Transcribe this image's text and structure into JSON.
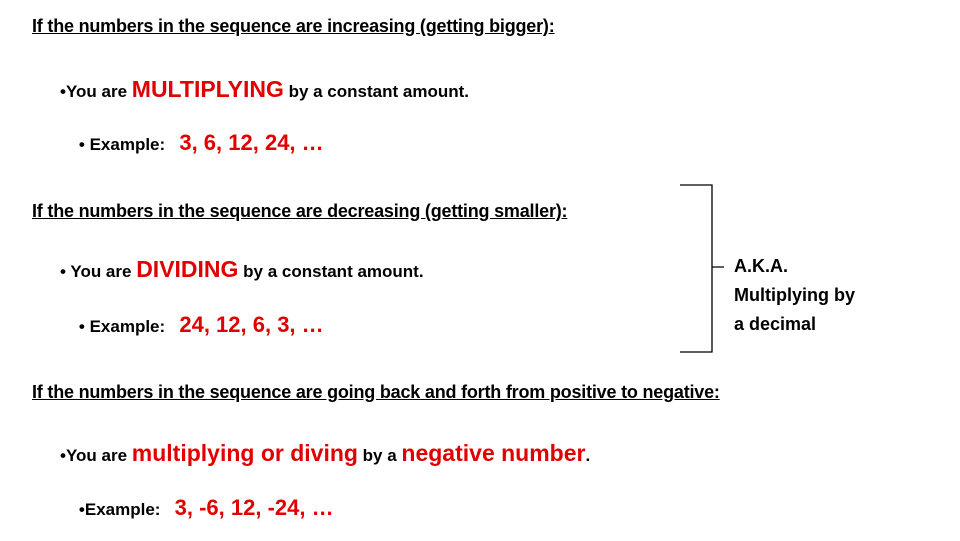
{
  "section1": {
    "heading": "If the numbers in the sequence are increasing (getting bigger):",
    "bullet1": {
      "prefix": "•You are ",
      "highlight": "MULTIPLYING",
      "suffix": " by a constant amount."
    },
    "bullet2": {
      "prefix": "• Example:   ",
      "example": "3, 6, 12, 24, …"
    }
  },
  "section2": {
    "heading": "If the numbers in the sequence are decreasing (getting smaller):",
    "bullet1": {
      "prefix": "• You are ",
      "highlight": "DIVIDING",
      "suffix": " by a constant amount."
    },
    "bullet2": {
      "prefix": "• Example:   ",
      "example": "24, 12, 6, 3, …"
    }
  },
  "aka": {
    "line1": "A.K.A.",
    "line2": "Multiplying by",
    "line3": "a decimal"
  },
  "section3": {
    "heading": "If the numbers in the sequence are going back and forth from positive to negative:",
    "bullet1": {
      "prefix": "•You are ",
      "highlight1": "multiplying or diving",
      "middle": " by a ",
      "highlight2": "negative number",
      "suffix": "."
    },
    "bullet2": {
      "prefix": "•Example:   ",
      "example": "3, -6, 12, -24, …"
    }
  },
  "colors": {
    "accent": "#e00000",
    "text": "#000000"
  }
}
